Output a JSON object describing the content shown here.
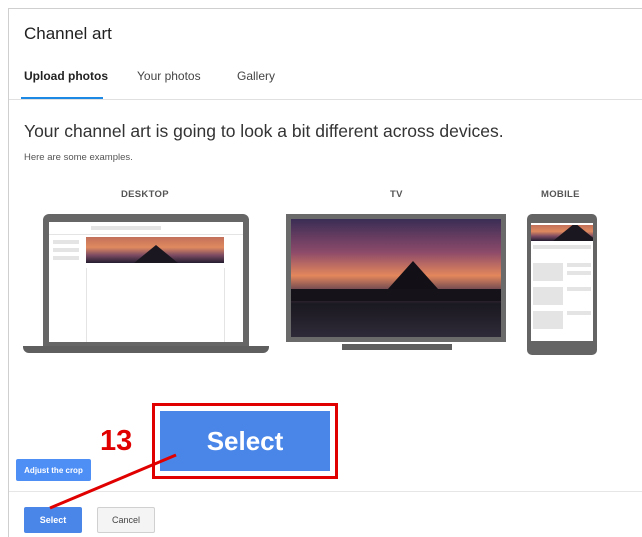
{
  "dialog": {
    "title": "Channel art",
    "tabs": [
      {
        "label": "Upload photos",
        "active": true
      },
      {
        "label": "Your photos",
        "active": false
      },
      {
        "label": "Gallery",
        "active": false
      }
    ],
    "headline": "Your channel art is going to look a bit different across devices.",
    "subtext": "Here are some examples.",
    "devices": {
      "desktop": "DESKTOP",
      "tv": "TV",
      "mobile": "MOBILE"
    },
    "adjust_crop_label": "Adjust the crop",
    "select_label": "Select",
    "cancel_label": "Cancel"
  },
  "annotation": {
    "step_number": "13",
    "zoomed_label": "Select",
    "color": "#e00000"
  },
  "colors": {
    "accent": "#1e88e5",
    "button_blue": "#4a86e8"
  }
}
